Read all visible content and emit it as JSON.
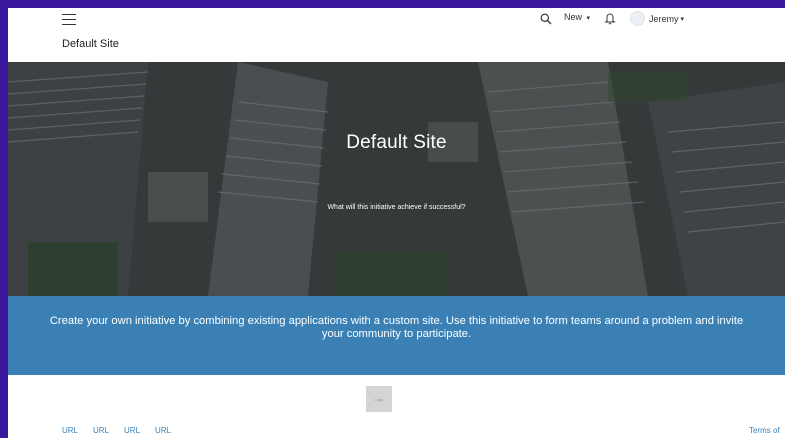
{
  "header": {
    "site_name": "Default Site",
    "new_label": "New",
    "user_name": "Jeremy",
    "caret": "▾"
  },
  "hero": {
    "title": "Default Site",
    "subtitle": "What will this initiative achieve if successful?"
  },
  "band": {
    "text": "Create your own initiative by combining existing applications with a custom site. Use this initiative to form teams around a problem and invite your community to participate."
  },
  "footer": {
    "logo_text": "Logo",
    "links": [
      "URL",
      "URL",
      "URL",
      "URL"
    ],
    "terms": "Terms of"
  },
  "colors": {
    "outer_background": "#3a189e",
    "band_blue": "#3a80b5",
    "link_blue": "#3a80b5"
  },
  "icons": [
    "menu-icon",
    "search-icon",
    "bell-icon",
    "avatar",
    "chevron-down-icon"
  ]
}
